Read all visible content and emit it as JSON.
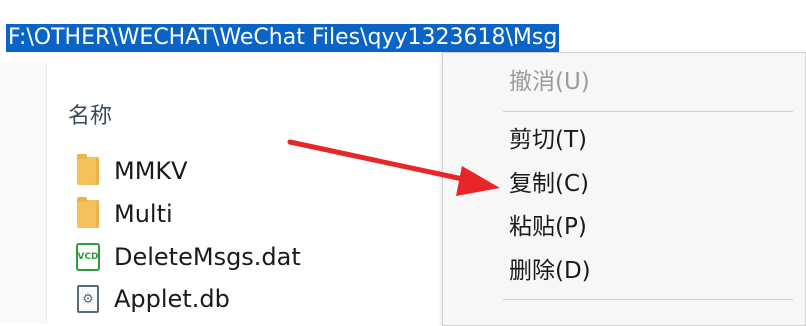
{
  "address_bar": {
    "path": "F:\\OTHER\\WECHAT\\WeChat Files\\qyy1323618\\Msg"
  },
  "file_list": {
    "column_header": "名称",
    "items": [
      {
        "name": "MMKV",
        "icon": "folder-icon"
      },
      {
        "name": "Multi",
        "icon": "folder-icon"
      },
      {
        "name": "DeleteMsgs.dat",
        "icon": "vcd-file-icon",
        "icon_text": "VCD"
      },
      {
        "name": "Applet.db",
        "icon": "db-file-icon"
      }
    ]
  },
  "context_menu": {
    "items": [
      {
        "label": "撤消(U)",
        "enabled": false
      },
      {
        "label": "剪切(T)",
        "enabled": true
      },
      {
        "label": "复制(C)",
        "enabled": true
      },
      {
        "label": "粘贴(P)",
        "enabled": true
      },
      {
        "label": "删除(D)",
        "enabled": true
      }
    ]
  },
  "colors": {
    "selection": "#0a64c8",
    "arrow": "#e8262a",
    "folder": "#f3c25a"
  }
}
